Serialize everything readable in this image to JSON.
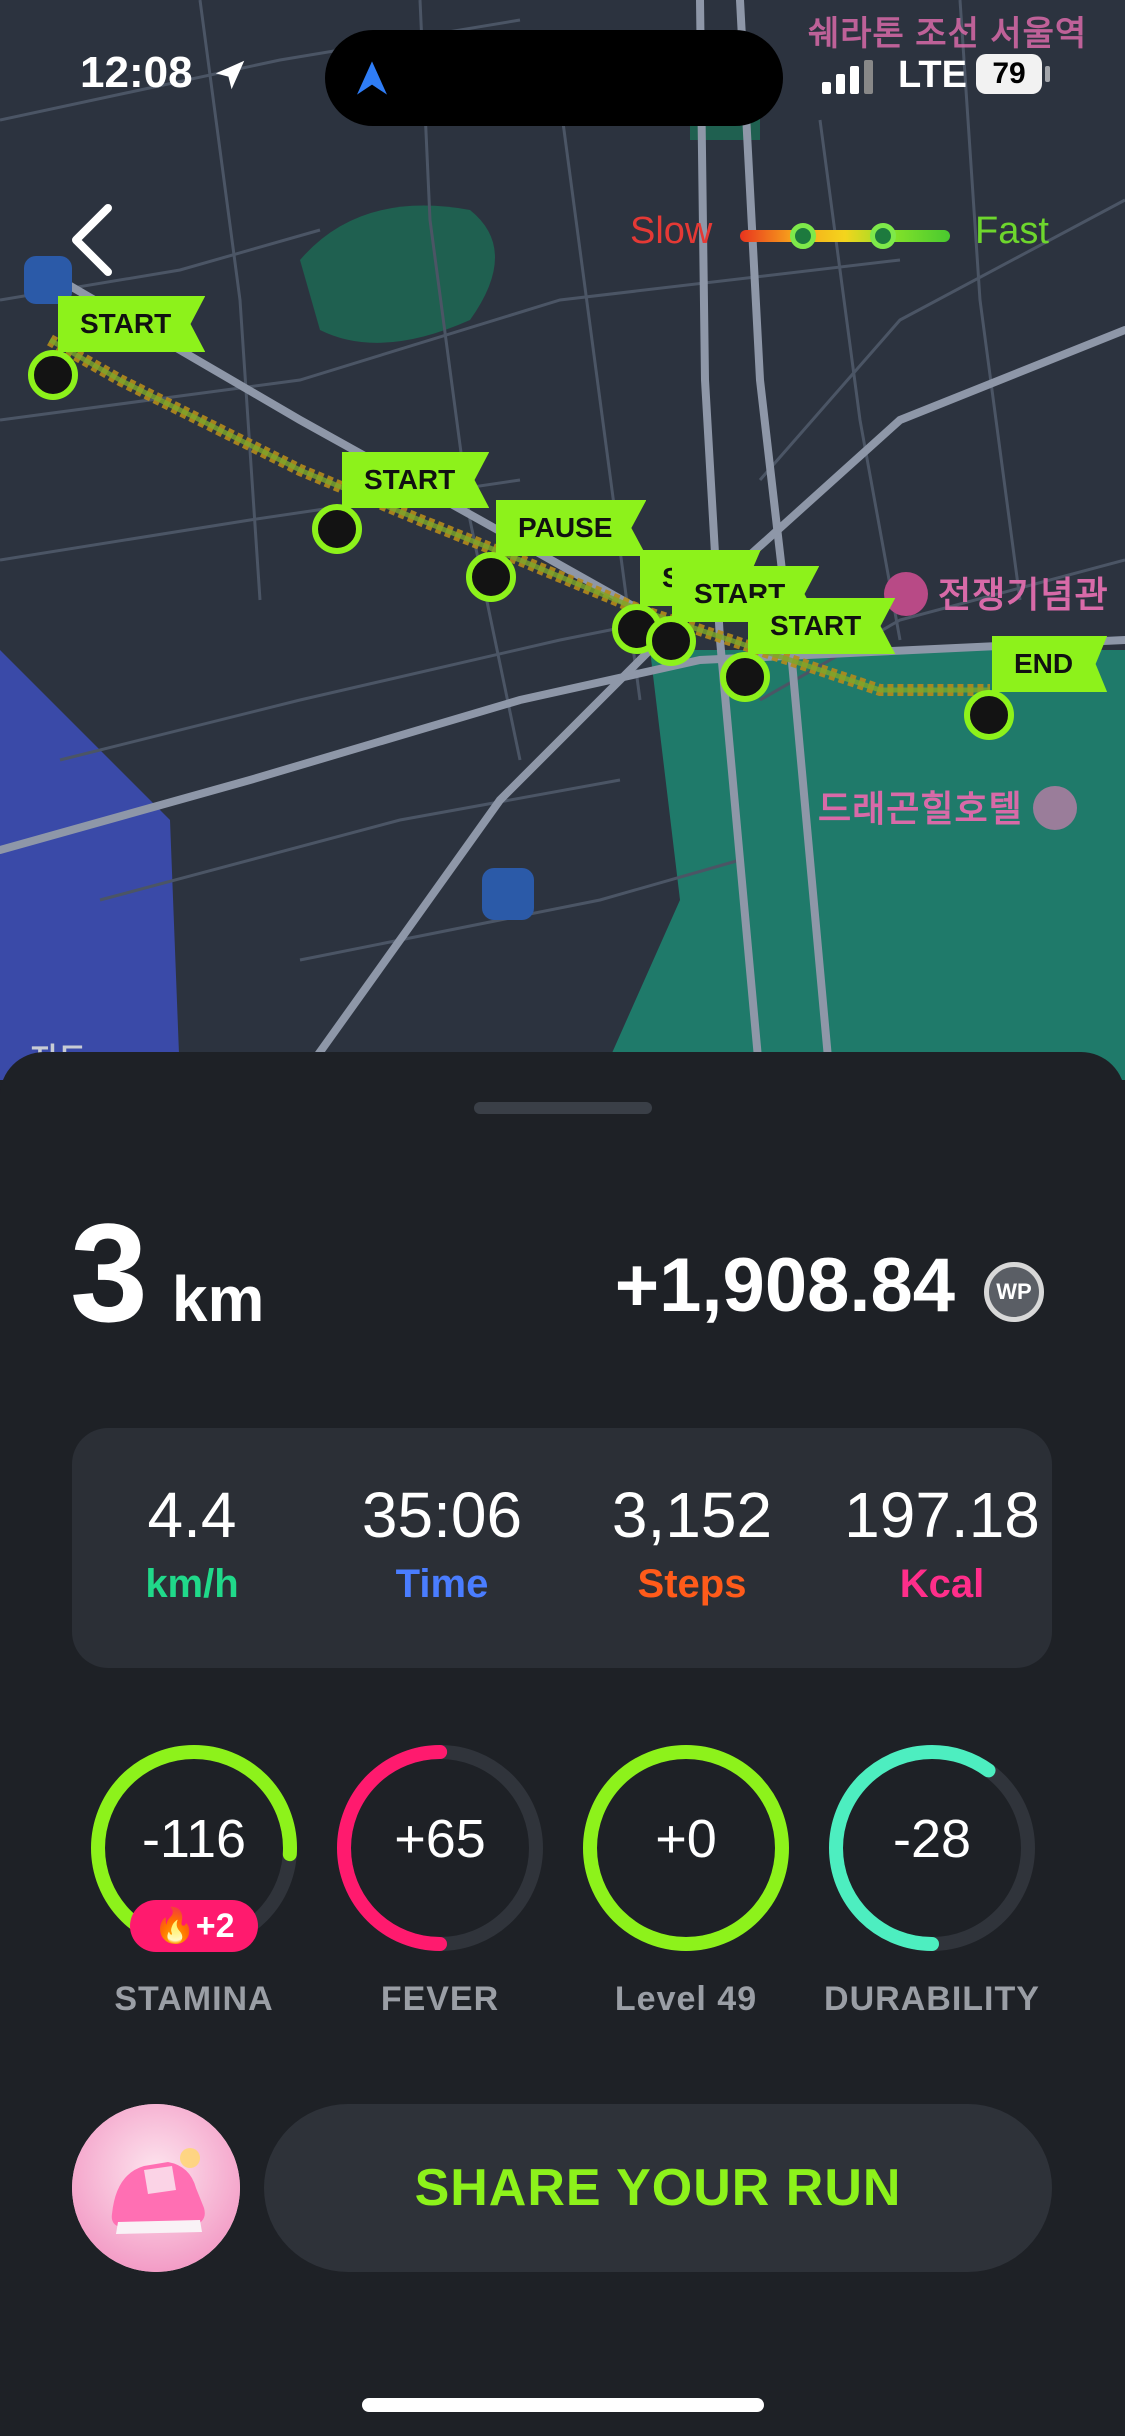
{
  "status_bar": {
    "time": "12:08",
    "network": "LTE",
    "battery": "79"
  },
  "map": {
    "legend": {
      "slow": "Slow",
      "fast": "Fast"
    },
    "labels": {
      "hotel_top": "쉐라톤 조선 서울역",
      "war_memorial": "전쟁기념관",
      "dragon_hill": "드래곤힐호텔",
      "map_corner": "지도"
    },
    "flags": {
      "start1": "START",
      "start2": "START",
      "pause": "PAUSE",
      "stub": "S",
      "start3": "START",
      "start4": "START",
      "end": "END"
    }
  },
  "summary": {
    "distance_value": "3",
    "distance_unit": "km",
    "wp_amount": "+1,908.84",
    "wp_icon": "WP"
  },
  "stats": [
    {
      "value": "4.4",
      "label": "km/h",
      "color": "#20d98a"
    },
    {
      "value": "35:06",
      "label": "Time",
      "color": "#4a7dff"
    },
    {
      "value": "3,152",
      "label": "Steps",
      "color": "#ff5b1a"
    },
    {
      "value": "197.18",
      "label": "Kcal",
      "color": "#ff2e8a"
    }
  ],
  "gauges": [
    {
      "value": "-116",
      "label": "STAMINA",
      "color": "#8df21b",
      "level": 0.76
    },
    {
      "value": "+65",
      "label": "FEVER",
      "color": "#ff1a6e",
      "level": 0.5
    },
    {
      "value": "+0",
      "label": "Level 49",
      "color": "#8df21b",
      "level": 1.0
    },
    {
      "value": "-28",
      "label": "DURABILITY",
      "color": "#4deec0",
      "level": 0.6
    }
  ],
  "stamina_boost": {
    "icon": "fire-icon",
    "value": "+2"
  },
  "share_button": "SHARE YOUR RUN"
}
